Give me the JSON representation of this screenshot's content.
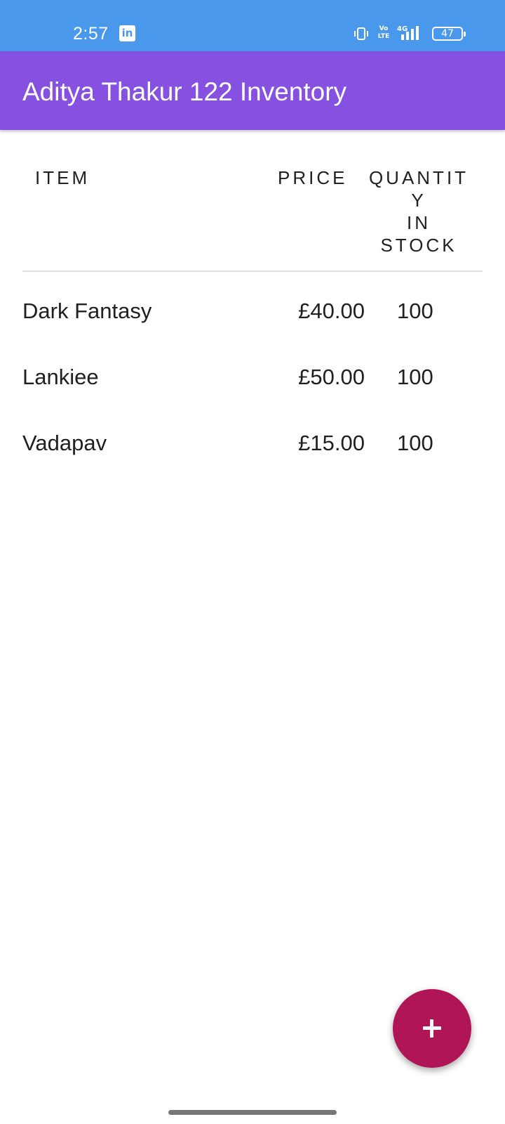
{
  "status_bar": {
    "time": "2:57",
    "notification_icon": "linkedin-icon",
    "volte_top": "Vo",
    "volte_bottom": "LTE",
    "network": "4G",
    "battery": "47"
  },
  "app_bar": {
    "title": "Aditya Thakur 122 Inventory"
  },
  "table": {
    "headers": {
      "item": "ITEM",
      "price": "PRICE",
      "quantity": "QUANTIT\nY\nIN\nSTOCK"
    },
    "rows": [
      {
        "item": "Dark Fantasy",
        "price": "£40.00",
        "quantity": "100"
      },
      {
        "item": "Lankiee",
        "price": "£50.00",
        "quantity": "100"
      },
      {
        "item": "Vadapav",
        "price": "£15.00",
        "quantity": "100"
      }
    ]
  },
  "fab": {
    "icon": "plus-icon"
  },
  "colors": {
    "status_bar": "#4a98ec",
    "app_bar": "#8651e0",
    "fab": "#b01656"
  }
}
